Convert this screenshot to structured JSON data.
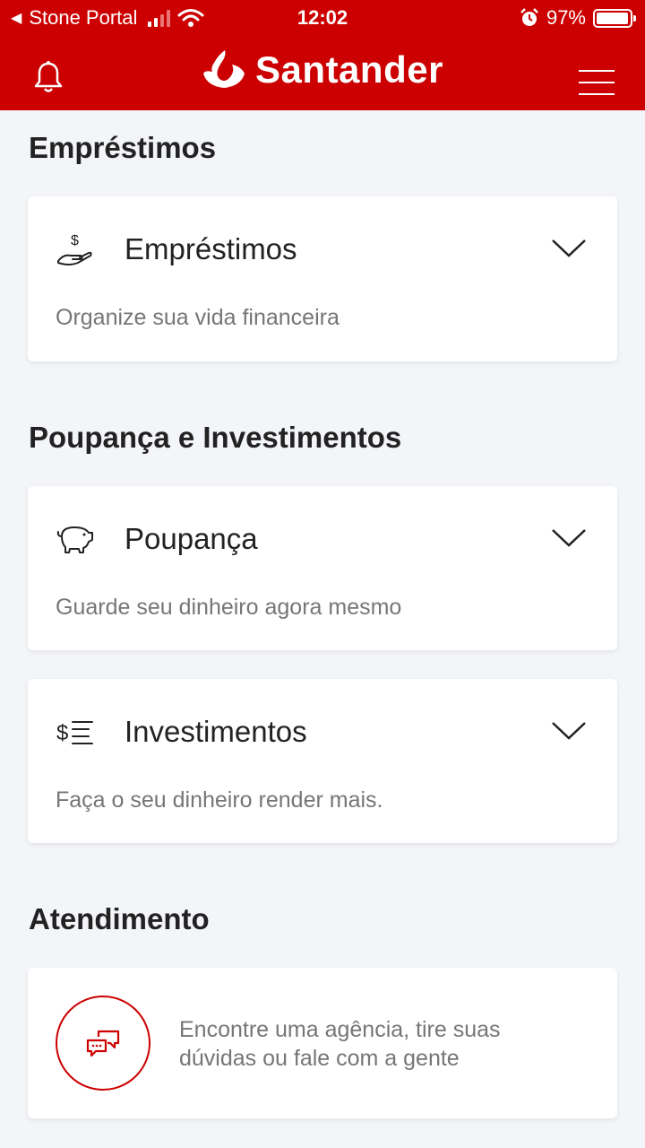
{
  "status_bar": {
    "back_app": "Stone Portal",
    "time": "12:02",
    "battery": "97%",
    "battery_level": 0.97
  },
  "header": {
    "brand": "Santander",
    "icons": [
      "bell-icon",
      "santander-flame-logo",
      "hamburger-menu-icon"
    ],
    "accent_color": "#cc0000"
  },
  "sections": {
    "loans": {
      "title": "Empréstimos",
      "card": {
        "icon": "hand-dollar-icon",
        "title": "Empréstimos",
        "description": "Organize sua vida financeira"
      }
    },
    "savings": {
      "title": "Poupança e Investimentos",
      "cards": [
        {
          "icon": "piggy-bank-icon",
          "title": "Poupança",
          "description": "Guarde seu dinheiro agora mesmo"
        },
        {
          "icon": "dollar-list-icon",
          "title": "Investimentos",
          "description": "Faça o seu dinheiro render mais."
        }
      ]
    },
    "support": {
      "title": "Atendimento",
      "card": {
        "icon": "chat-bubbles-icon",
        "description": "Encontre uma agência, tire suas dúvidas ou fale com a gente"
      }
    }
  }
}
